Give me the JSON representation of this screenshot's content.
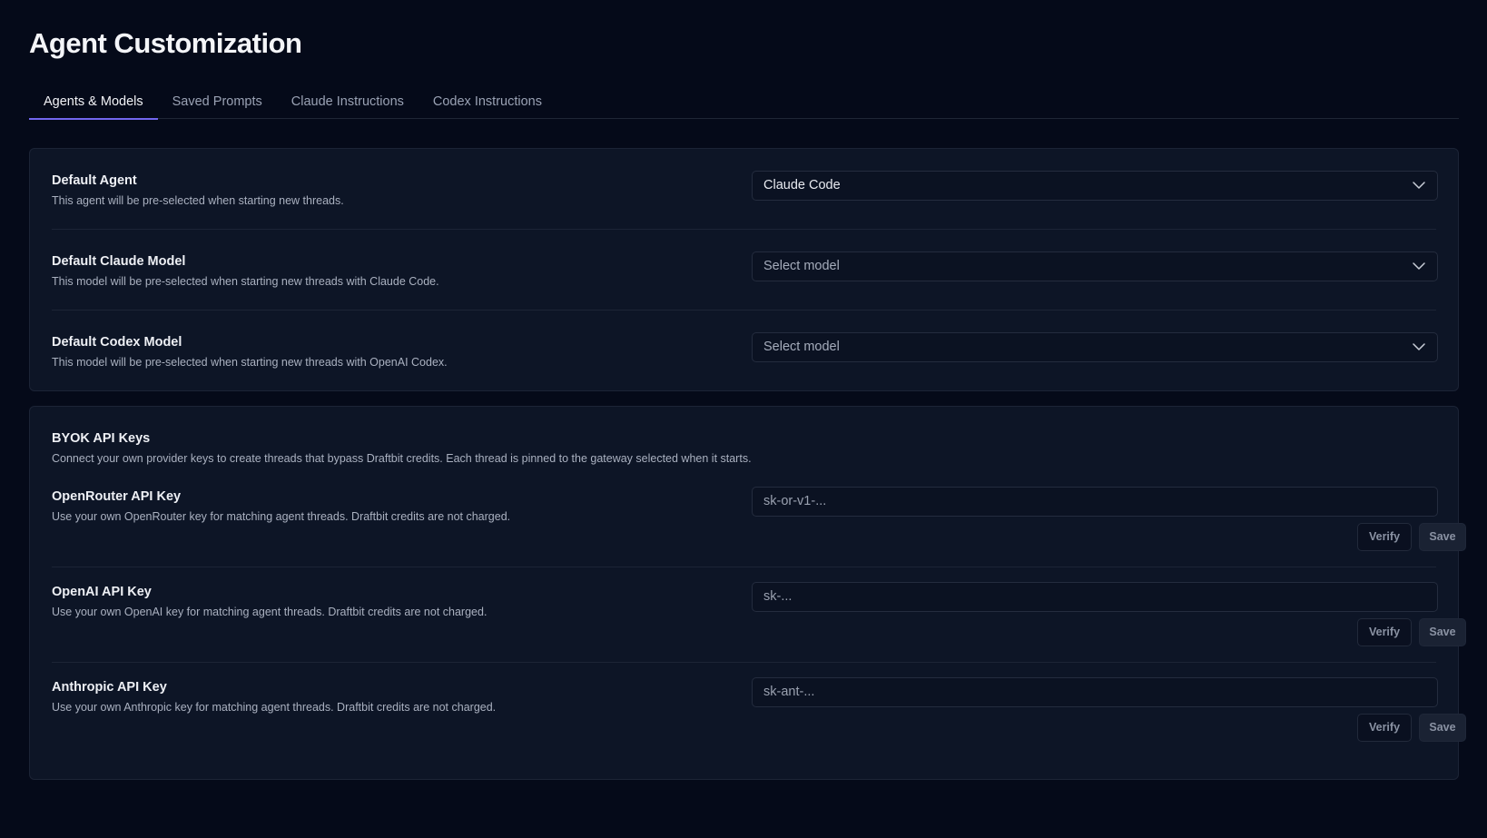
{
  "page": {
    "title": "Agent Customization"
  },
  "tabs": [
    {
      "label": "Agents & Models",
      "active": true
    },
    {
      "label": "Saved Prompts",
      "active": false
    },
    {
      "label": "Claude Instructions",
      "active": false
    },
    {
      "label": "Codex Instructions",
      "active": false
    }
  ],
  "agents": {
    "default_agent": {
      "label": "Default Agent",
      "description": "This agent will be pre-selected when starting new threads.",
      "value": "Claude Code"
    },
    "default_claude_model": {
      "label": "Default Claude Model",
      "description": "This model will be pre-selected when starting new threads with Claude Code.",
      "value": "Select model"
    },
    "default_codex_model": {
      "label": "Default Codex Model",
      "description": "This model will be pre-selected when starting new threads with OpenAI Codex.",
      "value": "Select model"
    }
  },
  "byok": {
    "title": "BYOK API Keys",
    "description": "Connect your own provider keys to create threads that bypass Draftbit credits. Each thread is pinned to the gateway selected when it starts.",
    "keys": [
      {
        "label": "OpenRouter API Key",
        "description": "Use your own OpenRouter key for matching agent threads. Draftbit credits are not charged.",
        "placeholder": "sk-or-v1-...",
        "verify_label": "Verify",
        "save_label": "Save"
      },
      {
        "label": "OpenAI API Key",
        "description": "Use your own OpenAI key for matching agent threads. Draftbit credits are not charged.",
        "placeholder": "sk-...",
        "verify_label": "Verify",
        "save_label": "Save"
      },
      {
        "label": "Anthropic API Key",
        "description": "Use your own Anthropic key for matching agent threads. Draftbit credits are not charged.",
        "placeholder": "sk-ant-...",
        "verify_label": "Verify",
        "save_label": "Save"
      }
    ]
  },
  "icons": {
    "select_chevron": "chevron-down-icon"
  },
  "colors": {
    "background": "#050a19",
    "card": "#0d1526",
    "accent": "#7267ef"
  }
}
